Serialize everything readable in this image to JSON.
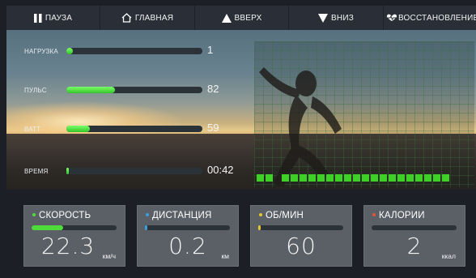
{
  "topbar": {
    "pause": {
      "label": "ПАУЗА",
      "icon": "pause-icon"
    },
    "home": {
      "label": "ГЛАВНАЯ",
      "icon": "home-icon"
    },
    "up": {
      "label": "ВВЕРХ",
      "icon": "triangle-up-icon"
    },
    "down": {
      "label": "ВНИЗ",
      "icon": "triangle-down-icon"
    },
    "recovery": {
      "label": "ВОССТАНОВЛЕНИЕ",
      "icon": "heart-rate-icon"
    }
  },
  "metrics": [
    {
      "label": "НАГРУЗКА",
      "value": "1",
      "level": 0.05
    },
    {
      "label": "ПУЛЬС",
      "value": "82",
      "level": 0.36
    },
    {
      "label": "ВАТТ",
      "value": "59",
      "level": 0.17
    },
    {
      "label": "ВРЕМЯ",
      "value": "00:42",
      "level": 0.01
    }
  ],
  "level_bars": {
    "filled": 21,
    "gap_after": 2
  },
  "cards": [
    {
      "title": "СКОРОСТЬ",
      "value": "22.3",
      "unit": "км/ч",
      "level": 0.37,
      "dot_color": "#4fdc3a",
      "fill_color": "#4fdc3a"
    },
    {
      "title": "ДИСТАНЦИЯ",
      "value": "0.2",
      "unit": "км",
      "level": 0.02,
      "dot_color": "#3aa0dc",
      "fill_color": "#3aa0dc"
    },
    {
      "title": "ОБ/МИН",
      "value": "60",
      "unit": "",
      "level": 0.03,
      "dot_color": "#e6c630",
      "fill_color": "#e6c630"
    },
    {
      "title": "КАЛОРИИ",
      "value": "2",
      "unit": "ккал",
      "level": 0.0,
      "dot_color": "#e0563a",
      "fill_color": "#e0563a"
    }
  ],
  "colors": {
    "accent_green": "#3fd028",
    "panel": "#2a2f37",
    "card": "#5b5f66"
  }
}
